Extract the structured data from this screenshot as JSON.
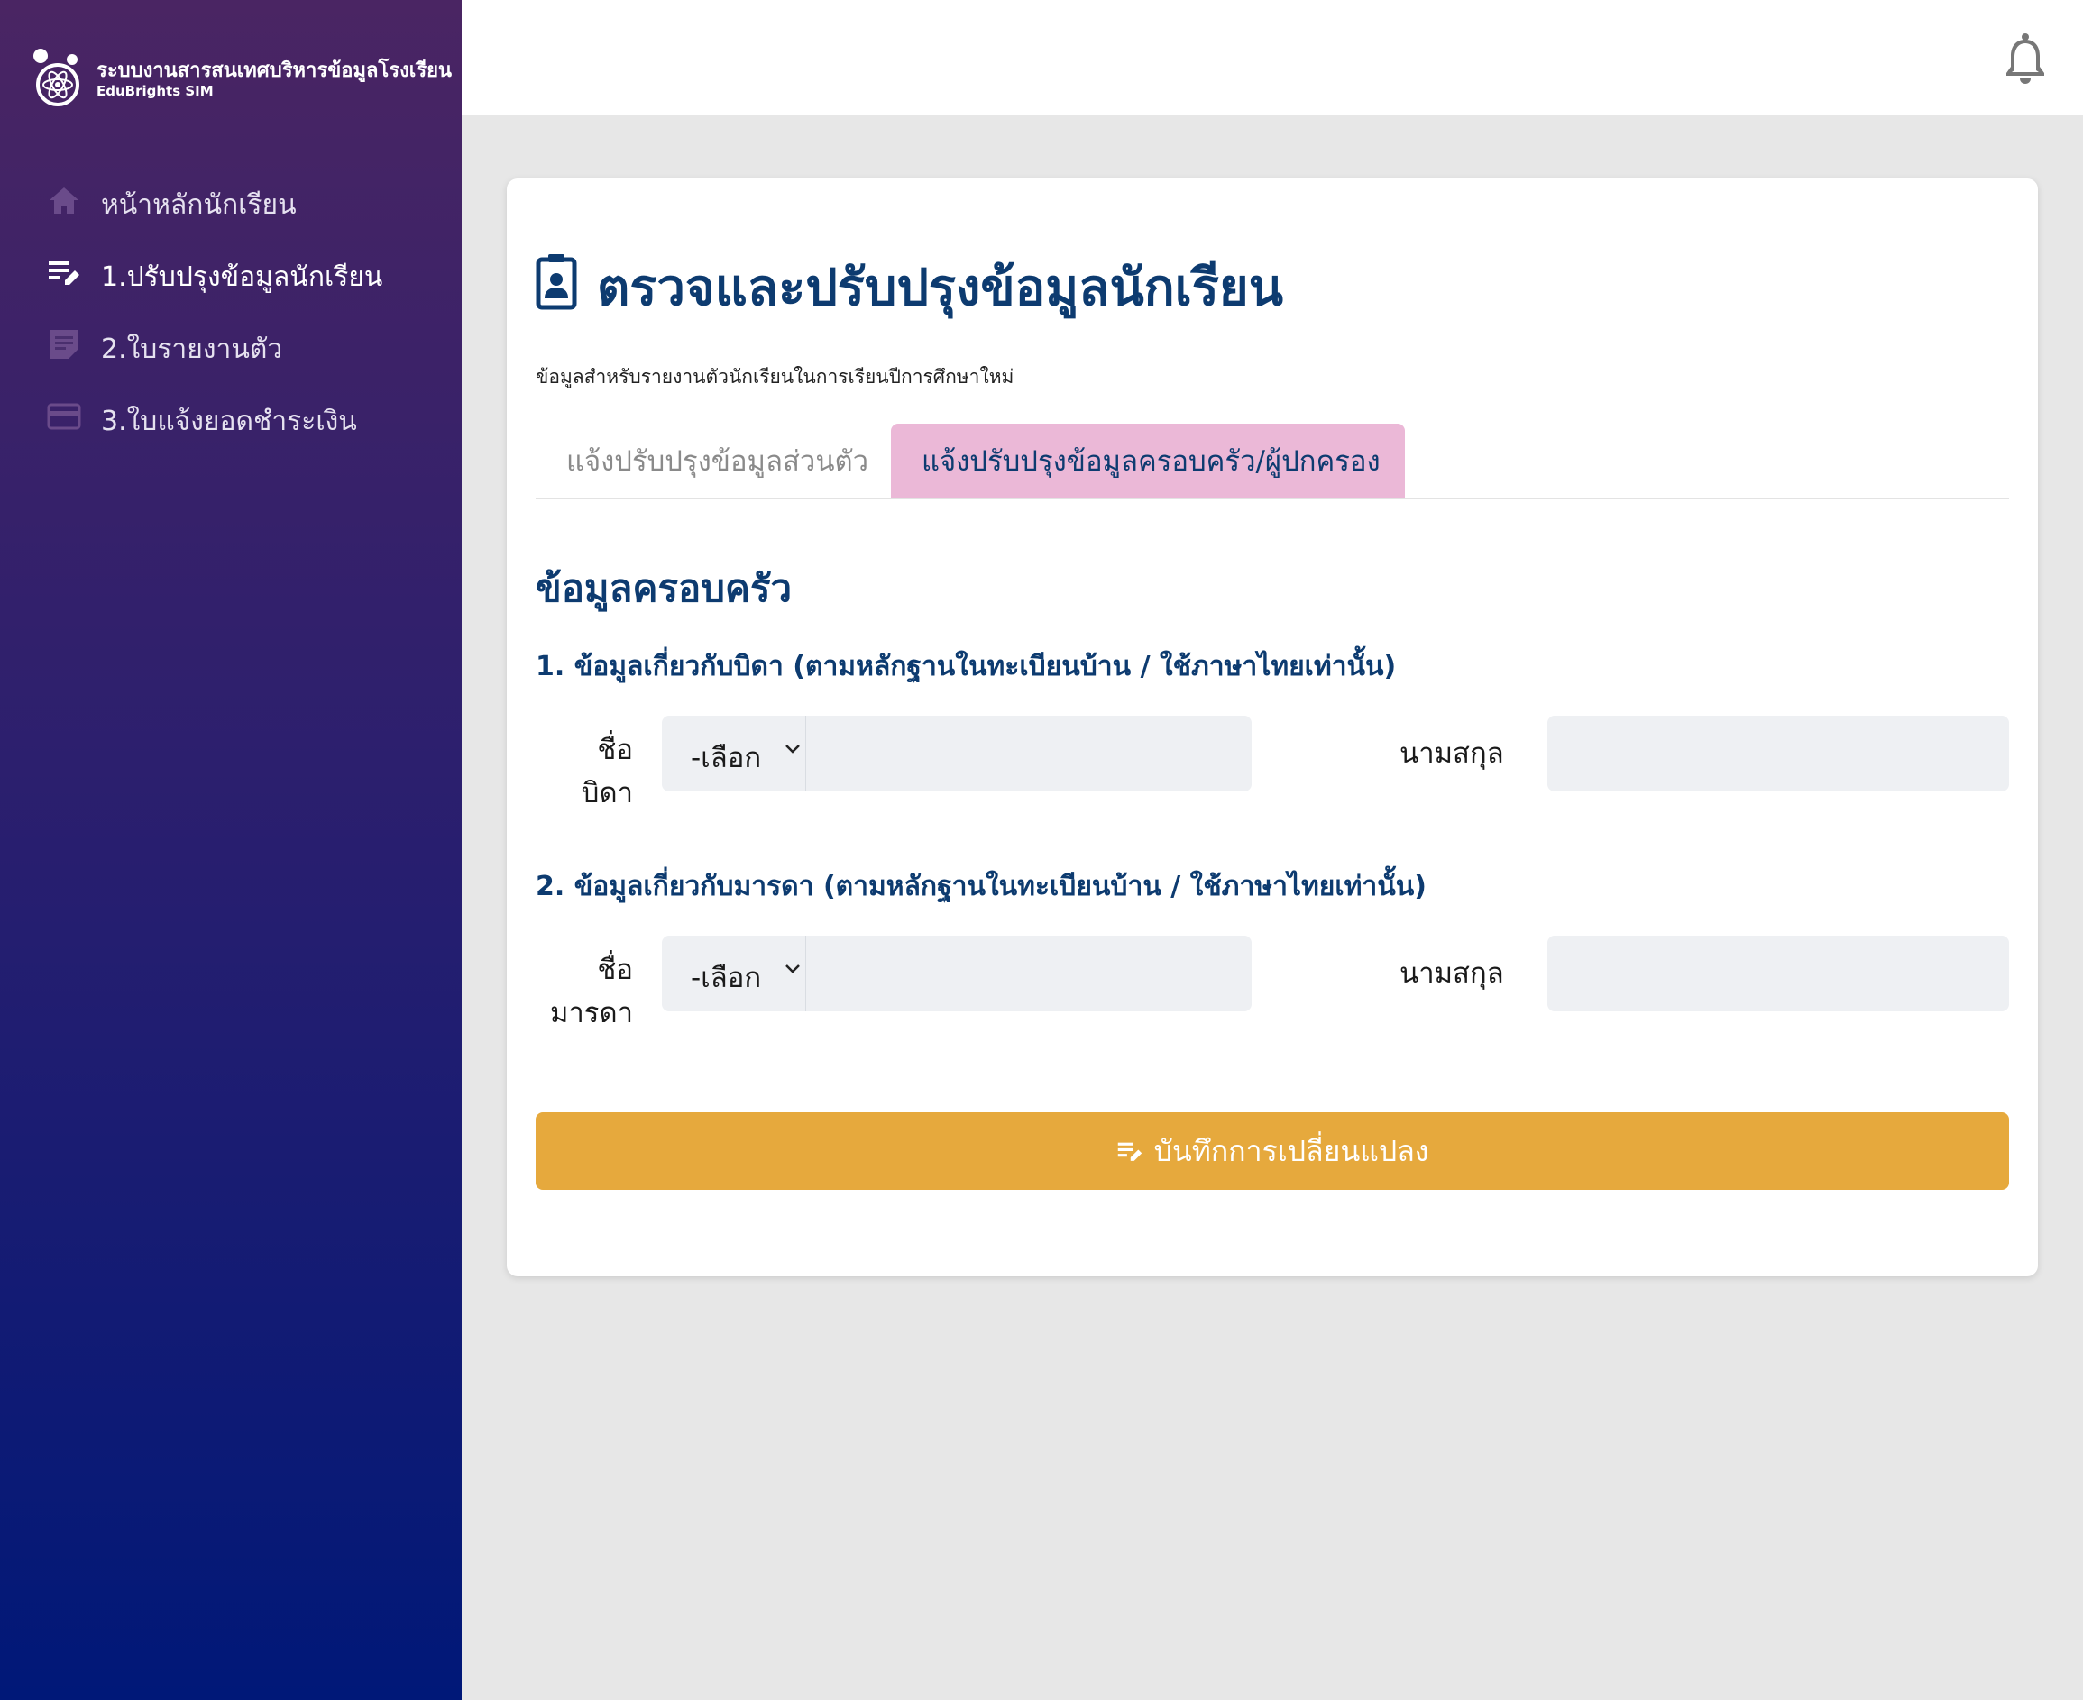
{
  "brand": {
    "title": "ระบบงานสารสนเทศบริหารข้อมูลโรงเรียน",
    "subtitle": "EduBrights SIM"
  },
  "sidebar": {
    "items": [
      {
        "label": "หน้าหลักนักเรียน",
        "icon": "home-icon"
      },
      {
        "label": "1.ปรับปรุงข้อมูลนักเรียน",
        "icon": "edit-list-icon"
      },
      {
        "label": "2.ใบรายงานตัว",
        "icon": "document-icon"
      },
      {
        "label": "3.ใบแจ้งยอดชำระเงิน",
        "icon": "credit-card-icon"
      }
    ]
  },
  "header": {
    "notification_icon": "bell-icon"
  },
  "main": {
    "title": "ตรวจและปรับปรุงข้อมูลนักเรียน",
    "description": "ข้อมูลสำหรับรายงานตัวนักเรียนในการเรียนปีการศึกษาใหม่",
    "tabs": [
      {
        "label": "แจ้งปรับปรุงข้อมูลส่วนตัว",
        "active": false
      },
      {
        "label": "แจ้งปรับปรุงข้อมูลครอบครัว/ผู้ปกครอง",
        "active": true
      }
    ],
    "section_title": "ข้อมูลครอบครัว",
    "father": {
      "heading": "1. ข้อมูลเกี่ยวกับบิดา (ตามหลักฐานในทะเบียนบ้าน / ใช้ภาษาไทยเท่านั้น)",
      "name_label_line1": "ชื่อ",
      "name_label_line2": "บิดา",
      "prefix_value": "-เลือก",
      "first_name_value": "",
      "surname_label": "นามสกุล",
      "surname_value": ""
    },
    "mother": {
      "heading": "2. ข้อมูลเกี่ยวกับมารดา (ตามหลักฐานในทะเบียนบ้าน / ใช้ภาษาไทยเท่านั้น)",
      "name_label_line1": "ชื่อ",
      "name_label_line2": "มารดา",
      "prefix_value": "-เลือก",
      "first_name_value": "",
      "surname_label": "นามสกุล",
      "surname_value": ""
    },
    "save_label": "บันทึกการเปลี่ยนแปลง"
  },
  "colors": {
    "sidebar_top": "#4a2563",
    "sidebar_bottom": "#001878",
    "title": "#0d3b70",
    "active_tab": "#ebb8d7",
    "save_button": "#e6a93d"
  }
}
